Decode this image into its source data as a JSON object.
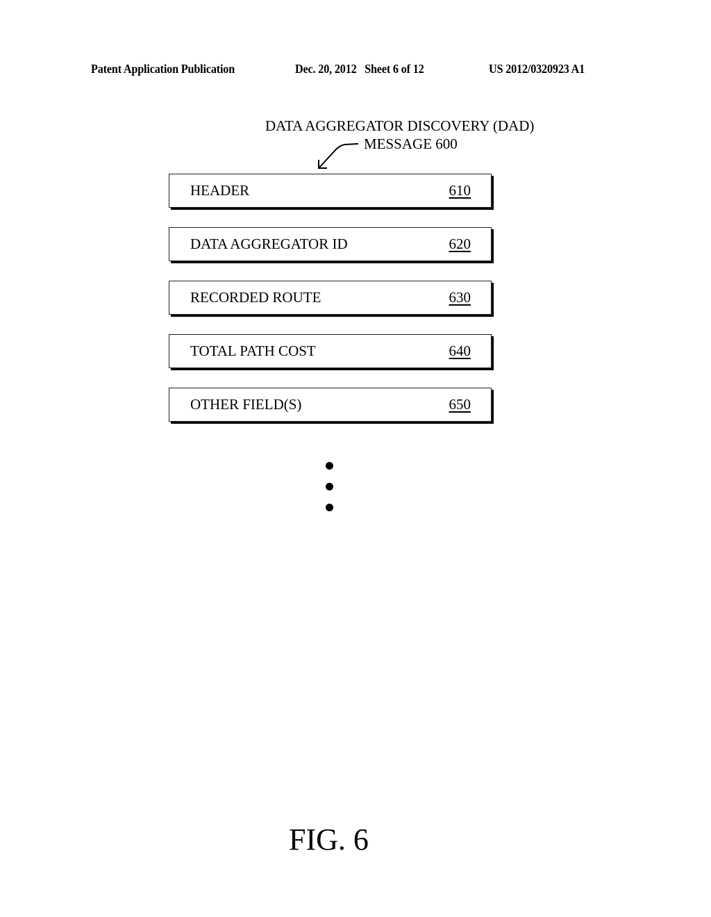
{
  "page_header": {
    "publication_type": "Patent Application Publication",
    "date_sheet": "Dec. 20, 2012   Sheet 6 of 12",
    "publication_number": "US 2012/0320923 A1"
  },
  "diagram": {
    "title_line1": "DATA AGGREGATOR DISCOVERY (DAD)",
    "title_line2": "MESSAGE 600",
    "fields": [
      {
        "label": "HEADER",
        "ref": "610"
      },
      {
        "label": "DATA AGGREGATOR ID",
        "ref": "620"
      },
      {
        "label": "RECORDED ROUTE",
        "ref": "630"
      },
      {
        "label": "TOTAL PATH COST",
        "ref": "640"
      },
      {
        "label": "OTHER FIELD(S)",
        "ref": "650"
      }
    ],
    "continuation": "vertical-ellipsis"
  },
  "figure_label": "FIG. 6"
}
